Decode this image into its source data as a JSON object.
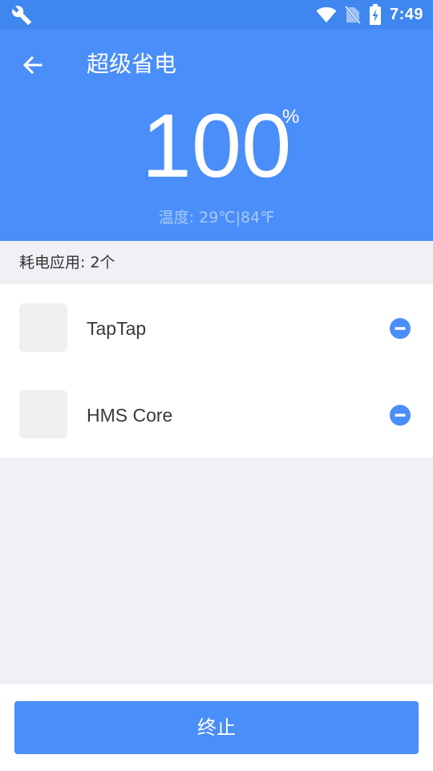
{
  "status_bar": {
    "time": "7:49",
    "icons": [
      "wrench-icon",
      "wifi-icon",
      "no-sim-icon",
      "battery-charging-icon"
    ]
  },
  "header": {
    "title": "超级省电",
    "battery_percent": "100",
    "percent_sign": "%",
    "temperature": "温度: 29℃|84℉"
  },
  "apps_section": {
    "label": "耗电应用: 2个",
    "items": [
      {
        "name": "TapTap",
        "action_icon": "remove-icon"
      },
      {
        "name": "HMS Core",
        "action_icon": "remove-icon"
      }
    ]
  },
  "footer": {
    "stop_label": "终止"
  },
  "colors": {
    "status_bar": "#3f86ef",
    "primary": "#4a8ef9",
    "background": "#eff1f5",
    "temperature_text": "#a9c9fb"
  }
}
